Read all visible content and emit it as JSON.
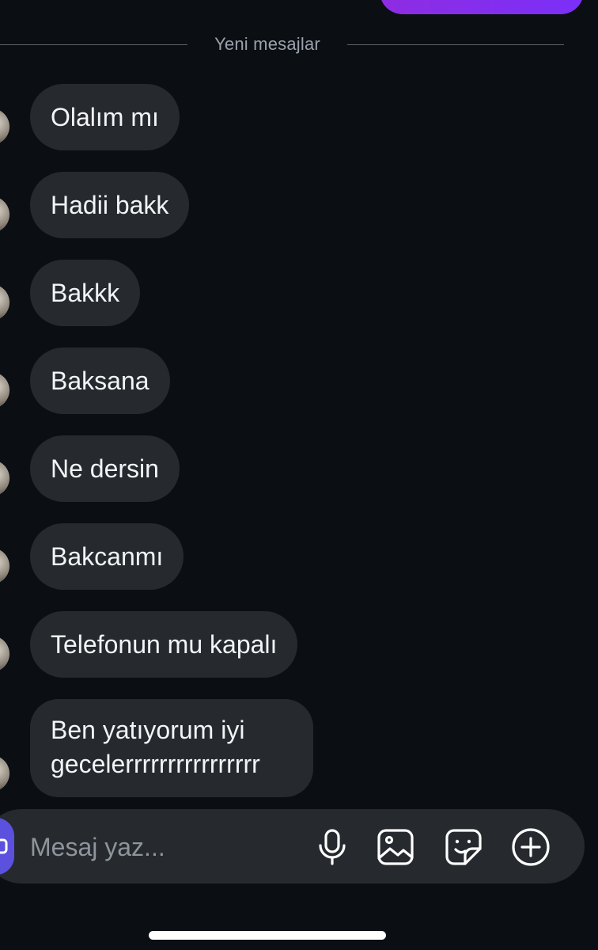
{
  "divider": {
    "label": "Yeni mesajlar"
  },
  "messages": [
    {
      "text": "Olalım mı"
    },
    {
      "text": "Hadii bakk"
    },
    {
      "text": "Bakkk"
    },
    {
      "text": "Baksana"
    },
    {
      "text": "Ne dersin"
    },
    {
      "text": "Bakcanmı"
    },
    {
      "text": "Telefonun mu kapalı"
    },
    {
      "text": "Ben yatıyorum iyi gecelerrrrrrrrrrrrrrrr"
    }
  ],
  "composer": {
    "placeholder": "Mesaj yaz...",
    "value": "",
    "icons": [
      "camera-icon",
      "microphone-icon",
      "gallery-icon",
      "sticker-icon",
      "plus-circle-icon"
    ]
  },
  "colors": {
    "background": "#0b0f13",
    "bubble": "#262a2e",
    "sent_bubble": "#8a2be2",
    "camera_button": "#5b51de",
    "divider_text": "#9aa2ab"
  }
}
